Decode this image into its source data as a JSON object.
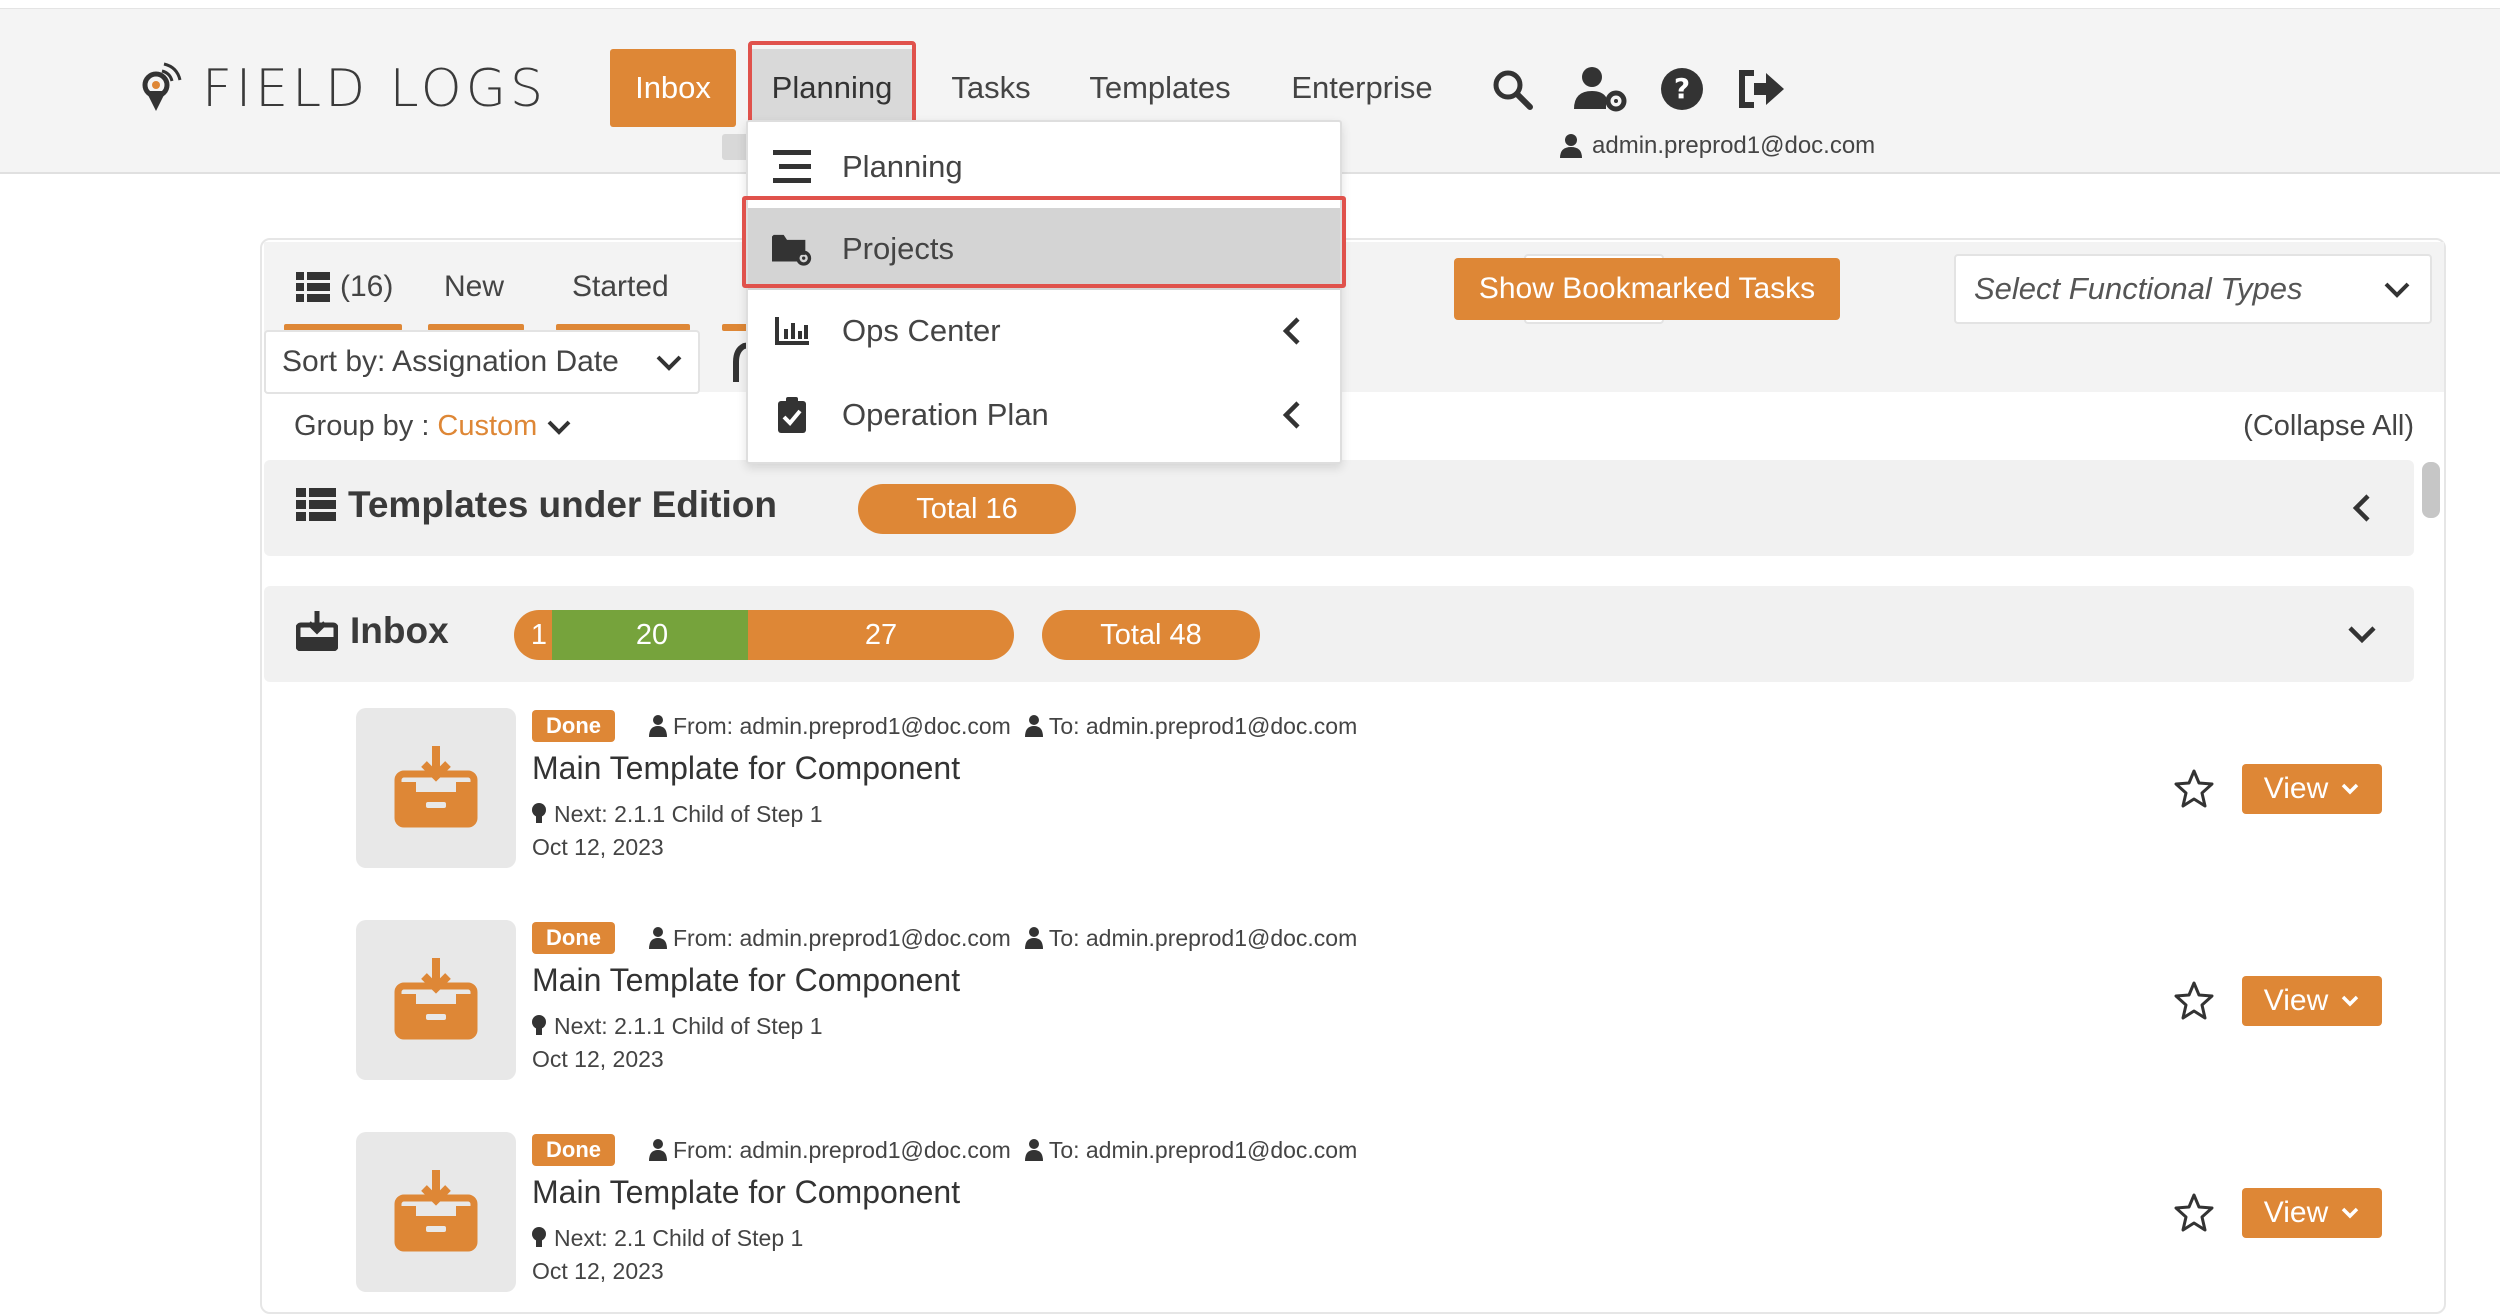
{
  "brand": {
    "name": "FIELD LOGS"
  },
  "nav": {
    "inbox": "Inbox",
    "planning": "Planning",
    "tasks": "Tasks",
    "templates": "Templates",
    "enterprise": "Enterprise"
  },
  "header_icons": [
    "search-icon",
    "user-settings-icon",
    "help-icon",
    "logout-icon"
  ],
  "user": {
    "email": "admin.preprod1@doc.com"
  },
  "planning_menu": {
    "items": [
      {
        "label": "Planning",
        "icon": "menu-lines-icon",
        "has_submenu": false
      },
      {
        "label": "Projects",
        "icon": "folder-gear-icon",
        "has_submenu": false,
        "selected": true
      },
      {
        "label": "Ops Center",
        "icon": "bar-chart-icon",
        "has_submenu": true
      },
      {
        "label": "Operation Plan",
        "icon": "clipboard-check-icon",
        "has_submenu": true
      }
    ]
  },
  "filters": {
    "tabs": [
      {
        "label": "(16)",
        "icon": "list-icon"
      },
      {
        "label": "New"
      },
      {
        "label": "Started"
      }
    ],
    "bookmark_button": "Show Bookmarked Tasks",
    "functional_types_placeholder": "Select Functional Types",
    "sort_label": "Sort by: Assignation Date",
    "group_by_label": "Group by :",
    "group_by_value": "Custom",
    "collapse_all": "(Collapse All)"
  },
  "sections": {
    "templates": {
      "title": "Templates under Edition",
      "total": "Total 16"
    },
    "inbox": {
      "title": "Inbox",
      "segments": [
        {
          "value": "1",
          "color": "#de8736"
        },
        {
          "value": "20",
          "color": "#76a33c"
        },
        {
          "value": "27",
          "color": "#de8736"
        }
      ],
      "total": "Total 48"
    }
  },
  "tasks": [
    {
      "status": "Done",
      "from": "From: admin.preprod1@doc.com",
      "to": "To: admin.preprod1@doc.com",
      "title": "Main Template for Component",
      "next": "Next: 2.1.1 Child of Step 1",
      "date": "Oct 12, 2023",
      "view": "View"
    },
    {
      "status": "Done",
      "from": "From: admin.preprod1@doc.com",
      "to": "To: admin.preprod1@doc.com",
      "title": "Main Template for Component",
      "next": "Next: 2.1.1 Child of Step 1",
      "date": "Oct 12, 2023",
      "view": "View"
    },
    {
      "status": "Done",
      "from": "From: admin.preprod1@doc.com",
      "to": "To: admin.preprod1@doc.com",
      "title": "Main Template for Component",
      "next": "Next: 2.1 Child of Step 1",
      "date": "Oct 12, 2023",
      "view": "View"
    }
  ],
  "colors": {
    "accent": "#de8736",
    "green": "#76a33c",
    "highlight": "#e0524c"
  }
}
